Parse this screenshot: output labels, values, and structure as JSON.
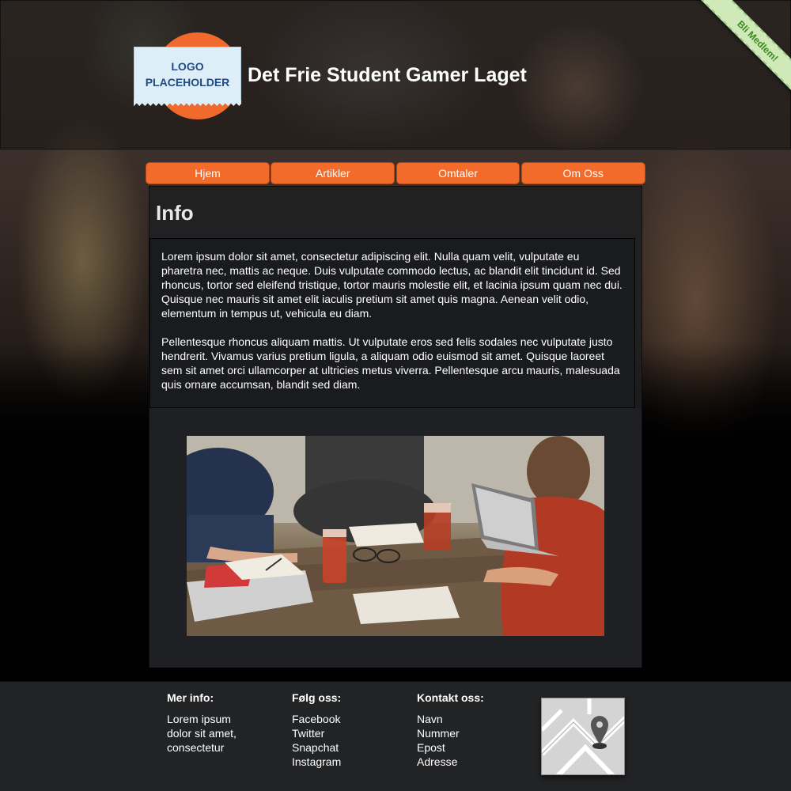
{
  "header": {
    "logo_text": "LOGO\nPLACEHOLDER",
    "title": "Det Frie Student Gamer Laget",
    "ribbon": "Bli Medlem!"
  },
  "nav": {
    "items": [
      {
        "label": "Hjem"
      },
      {
        "label": "Artikler"
      },
      {
        "label": "Omtaler"
      },
      {
        "label": "Om Oss"
      }
    ]
  },
  "main": {
    "title": "Info",
    "paragraphs": [
      "Lorem ipsum dolor sit amet, consectetur adipiscing elit. Nulla quam velit, vulputate eu pharetra nec, mattis ac neque. Duis vulputate commodo lectus, ac blandit elit tincidunt id. Sed rhoncus, tortor sed eleifend tristique, tortor mauris molestie elit, et lacinia ipsum quam nec dui. Quisque nec mauris sit amet elit iaculis pretium sit amet quis magna. Aenean velit odio, elementum in tempus ut, vehicula eu diam.",
      "Pellentesque rhoncus aliquam mattis. Ut vulputate eros sed felis sodales nec vulputate justo hendrerit. Vivamus varius pretium ligula, a aliquam odio euismod sit amet. Quisque laoreet sem sit amet orci ullamcorper at ultricies metus viverra. Pellentesque arcu mauris, malesuada quis ornare accumsan, blandit sed diam."
    ]
  },
  "footer": {
    "info": {
      "heading": "Mer info:",
      "lines": [
        "Lorem ipsum",
        "dolor sit amet,",
        "consectetur"
      ]
    },
    "follow": {
      "heading": "Følg oss:",
      "lines": [
        "Facebook",
        "Twitter",
        "Snapchat",
        "Instagram"
      ]
    },
    "contact": {
      "heading": "Kontakt oss:",
      "lines": [
        "Navn",
        "Nummer",
        "Epost",
        "Adresse"
      ]
    }
  },
  "colors": {
    "accent": "#f26b2b",
    "ribbon": "#cfe9b9",
    "panel": "#1f2023",
    "footer": "#222325"
  },
  "icons": {
    "map": "map-pin-icon"
  }
}
